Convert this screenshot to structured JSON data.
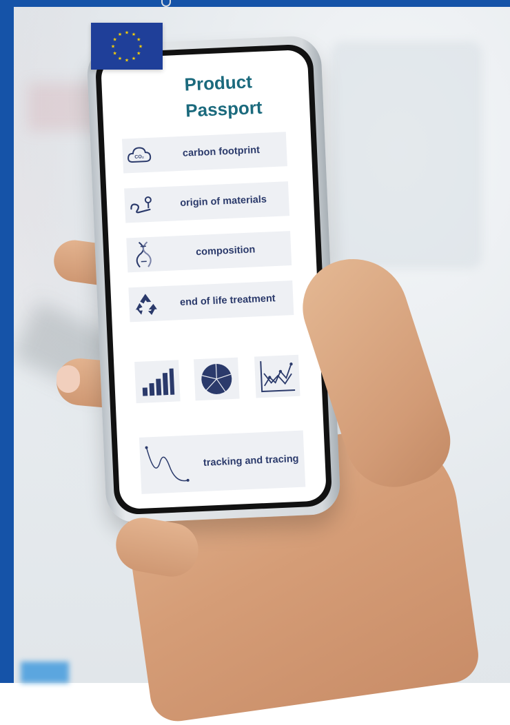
{
  "colors": {
    "eu_blue": "#1553a8",
    "title_teal": "#1b6a7d",
    "label_navy": "#2b3a6b",
    "row_bg": "#eef0f4",
    "flag_star": "#ffd400"
  },
  "phone": {
    "title_line1": "Product",
    "title_line2": "Passport",
    "rows": [
      {
        "label": "carbon footprint",
        "icon": "co2-cloud-icon"
      },
      {
        "label": "origin of materials",
        "icon": "route-icon"
      },
      {
        "label": "composition",
        "icon": "dna-icon"
      },
      {
        "label": "end of life treatment",
        "icon": "recycle-icon"
      }
    ],
    "charts": [
      {
        "icon": "bar-chart-icon"
      },
      {
        "icon": "pie-chart-icon"
      },
      {
        "icon": "line-chart-icon"
      }
    ],
    "tracking": {
      "label": "tracking and tracing",
      "icon": "tracking-path-icon"
    }
  },
  "flag": {
    "icon": "eu-flag-icon"
  }
}
